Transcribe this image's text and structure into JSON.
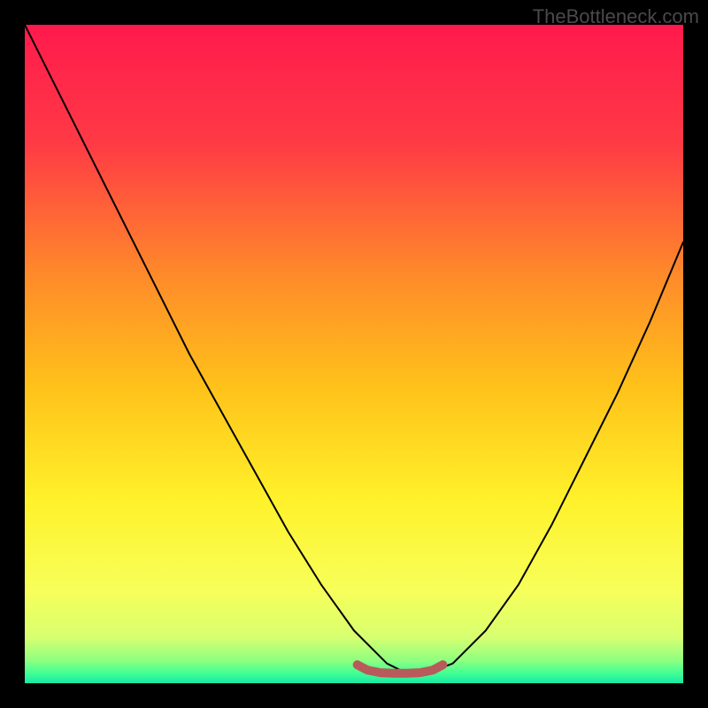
{
  "watermark": "TheBottleneck.com",
  "gradient_stops": [
    {
      "offset": 0.0,
      "color": "#ff1a4d"
    },
    {
      "offset": 0.18,
      "color": "#ff3a45"
    },
    {
      "offset": 0.38,
      "color": "#ff8a2a"
    },
    {
      "offset": 0.55,
      "color": "#ffc21a"
    },
    {
      "offset": 0.72,
      "color": "#fff12a"
    },
    {
      "offset": 0.86,
      "color": "#f7ff5a"
    },
    {
      "offset": 0.93,
      "color": "#d8ff70"
    },
    {
      "offset": 0.965,
      "color": "#8fff80"
    },
    {
      "offset": 0.985,
      "color": "#40ff95"
    },
    {
      "offset": 1.0,
      "color": "#18e8a5"
    }
  ],
  "chart_data": {
    "type": "line",
    "title": "",
    "xlabel": "",
    "ylabel": "",
    "xlim": [
      0,
      1
    ],
    "ylim": [
      0,
      1
    ],
    "grid": false,
    "series": [
      {
        "name": "bottleneck-curve",
        "x": [
          0.0,
          0.05,
          0.1,
          0.15,
          0.2,
          0.25,
          0.3,
          0.35,
          0.4,
          0.45,
          0.5,
          0.55,
          0.58,
          0.61,
          0.65,
          0.7,
          0.75,
          0.8,
          0.85,
          0.9,
          0.95,
          1.0
        ],
        "values": [
          1.0,
          0.9,
          0.8,
          0.7,
          0.6,
          0.5,
          0.41,
          0.32,
          0.23,
          0.15,
          0.08,
          0.03,
          0.015,
          0.015,
          0.03,
          0.08,
          0.15,
          0.24,
          0.34,
          0.44,
          0.55,
          0.67
        ]
      },
      {
        "name": "bottom-highlight",
        "color": "#b85a5a",
        "x": [
          0.505,
          0.52,
          0.54,
          0.56,
          0.58,
          0.6,
          0.62,
          0.635
        ],
        "values": [
          0.028,
          0.02,
          0.016,
          0.015,
          0.015,
          0.016,
          0.02,
          0.028
        ]
      }
    ],
    "annotations": []
  }
}
